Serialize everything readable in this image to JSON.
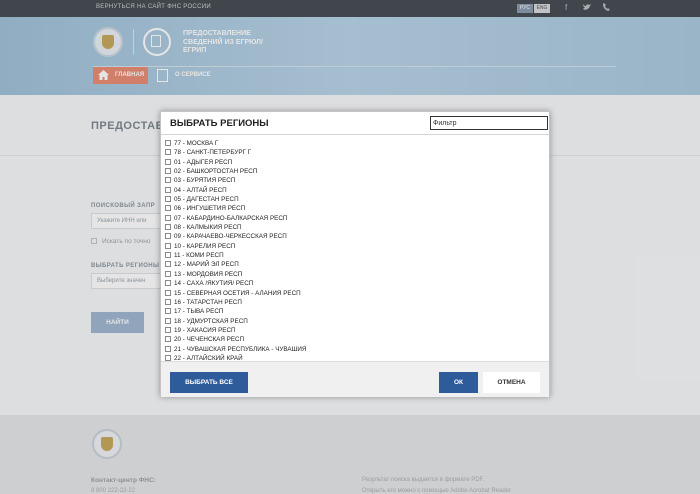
{
  "topbar": {
    "back_link": "ВЕРНУТЬСЯ НА САЙТ ФНС РОССИИ",
    "lang_ru": "РУС",
    "lang_en": "ENG",
    "social_icons": [
      "facebook-icon",
      "twitter-icon",
      "phone-icon"
    ]
  },
  "header": {
    "service_title": "ПРЕДОСТАВЛЕНИЕ СВЕДЕНИЙ ИЗ ЕГРЮЛ/ЕГРИП",
    "nav": {
      "home": "ГЛАВНАЯ",
      "about": "О СЕРВИСЕ"
    },
    "colors": {
      "header_bg": "#b7d3e7",
      "home_tab": "#e98b72"
    }
  },
  "main": {
    "page_title": "ПРЕДОСТАВ",
    "search_label": "ПОИСКОВЫЙ ЗАПР",
    "search_placeholder": "Укажите ИНН или",
    "exact_search_label": "Искать по точно",
    "region_label": "ВЫБРАТЬ РЕГИОНЫ",
    "region_placeholder": "Выберите значен",
    "find_button": "НАЙТИ"
  },
  "modal": {
    "title": "ВЫБРАТЬ РЕГИОНЫ",
    "filter_value": "Фильтр",
    "regions": [
      "77 - МОСКВА Г",
      "78 - САНКТ-ПЕТЕРБУРГ Г",
      "01 - АДЫГЕЯ РЕСП",
      "02 - БАШКОРТОСТАН РЕСП",
      "03 - БУРЯТИЯ РЕСП",
      "04 - АЛТАЙ РЕСП",
      "05 - ДАГЕСТАН РЕСП",
      "06 - ИНГУШЕТИЯ РЕСП",
      "07 - КАБАРДИНО-БАЛКАРСКАЯ РЕСП",
      "08 - КАЛМЫКИЯ РЕСП",
      "09 - КАРАЧАЕВО-ЧЕРКЕССКАЯ РЕСП",
      "10 - КАРЕЛИЯ РЕСП",
      "11 - КОМИ РЕСП",
      "12 - МАРИЙ ЭЛ РЕСП",
      "13 - МОРДОВИЯ РЕСП",
      "14 - САХА /ЯКУТИЯ/ РЕСП",
      "15 - СЕВЕРНАЯ ОСЕТИЯ - АЛАНИЯ РЕСП",
      "16 - ТАТАРСТАН РЕСП",
      "17 - ТЫВА РЕСП",
      "18 - УДМУРТСКАЯ РЕСП",
      "19 - ХАКАСИЯ РЕСП",
      "20 - ЧЕЧЕНСКАЯ РЕСП",
      "21 - ЧУВАШСКАЯ РЕСПУБЛИКА - ЧУВАШИЯ",
      "22 - АЛТАЙСКИЙ КРАЙ"
    ],
    "select_all_button": "ВЫБРАТЬ ВСЕ",
    "ok_button": "ОК",
    "cancel_button": "ОТМЕНА",
    "colors": {
      "primary_button": "#2e5b9a"
    }
  },
  "footer": {
    "contact_label": "Контакт-центр ФНС:",
    "phone": "8 800 222-22-22",
    "note_line1": "Результат поиска выдается в формате PDF.",
    "note_line2": "Открыть его можно с помощью Adobe Acrobat Reader"
  }
}
